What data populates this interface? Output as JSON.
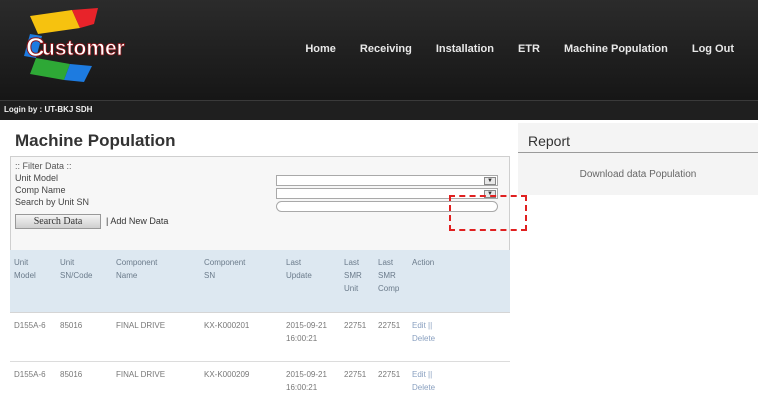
{
  "brand": {
    "logo_text": "Customer",
    "logo_colors": [
      "#e8232a",
      "#f6c20f",
      "#1d7be0",
      "#2ea836"
    ]
  },
  "nav": {
    "items": [
      "Home",
      "Receiving",
      "Installation",
      "ETR",
      "Machine Population",
      "Log Out"
    ]
  },
  "login": {
    "text": "Login by : UT-BKJ SDH"
  },
  "page": {
    "title": "Machine Population"
  },
  "filter": {
    "title": ":: Filter Data ::",
    "unit_model_label": "Unit Model",
    "comp_name_label": "Comp Name",
    "search_sn_label": "Search by Unit SN",
    "search_button": "Search Data",
    "add_link": "| Add New Data"
  },
  "table": {
    "headers": [
      [
        "Unit",
        "Model"
      ],
      [
        "Unit",
        "SN/Code"
      ],
      [
        "Component",
        "Name"
      ],
      [
        "Component",
        "SN"
      ],
      [
        "Last",
        "Update"
      ],
      [
        "Last",
        "SMR",
        "Unit"
      ],
      [
        "Last",
        "SMR",
        "Comp"
      ],
      [
        "Action"
      ]
    ],
    "rows": [
      {
        "unit_model": "D155A-6",
        "unit_sn": "85016",
        "comp_name": "FINAL DRIVE",
        "comp_sn": "KX-K000201",
        "last_update_date": "2015-09-21",
        "last_update_time": "16:00:21",
        "smr_unit": "22751",
        "smr_comp": "22751",
        "edit": "Edit ||",
        "delete": "Delete"
      },
      {
        "unit_model": "D155A-6",
        "unit_sn": "85016",
        "comp_name": "FINAL DRIVE",
        "comp_sn": "KX-K000209",
        "last_update_date": "2015-09-21",
        "last_update_time": "16:00:21",
        "smr_unit": "22751",
        "smr_comp": "22751",
        "edit": "Edit ||",
        "delete": "Delete"
      }
    ]
  },
  "report": {
    "title": "Report",
    "download_link": "Download data Population"
  },
  "colors": {
    "topbar": "#1e1e1e",
    "callout": "#e02020",
    "table_header": "#dde8f1"
  }
}
